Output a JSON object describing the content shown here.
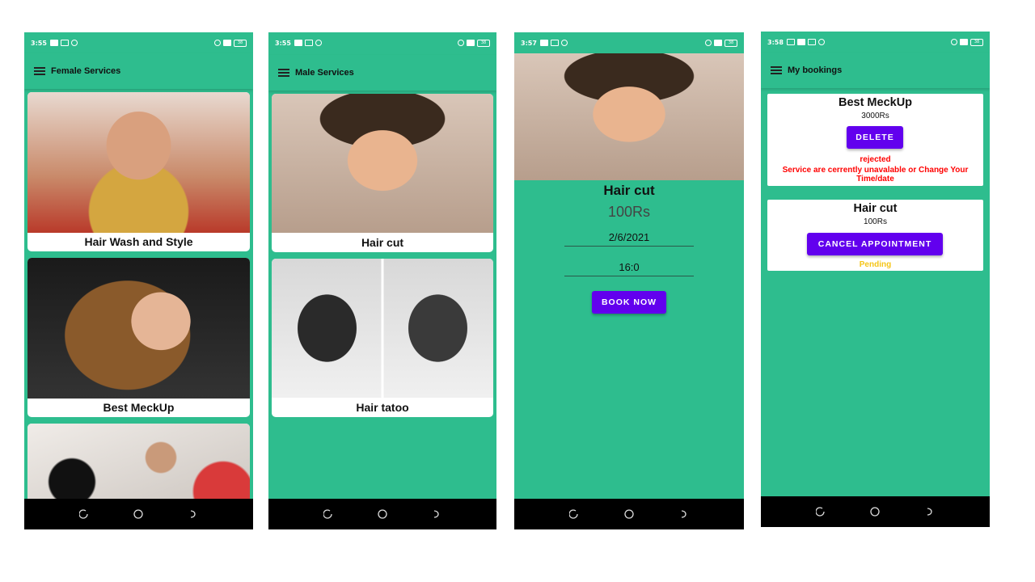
{
  "screens": {
    "female": {
      "time": "3:55",
      "battery": "38",
      "title": "Female Services",
      "cards": [
        "Hair Wash and Style",
        "Best MeckUp"
      ]
    },
    "male": {
      "time": "3:55",
      "battery": "38",
      "title": "Male Services",
      "cards": [
        "Hair cut",
        "Hair tatoo"
      ]
    },
    "detail": {
      "time": "3:57",
      "battery": "38",
      "service_name": "Hair cut",
      "price": "100Rs",
      "date": "2/6/2021",
      "time_value": "16:0",
      "book_button": "BOOK NOW"
    },
    "bookings": {
      "time": "3:58",
      "battery": "38",
      "title": "My bookings",
      "items": [
        {
          "name": "Best MeckUp",
          "price": "3000Rs",
          "button": "DELETE",
          "status": "rejected",
          "message": "Service are cerrently unavalable or Change Your Time/date",
          "status_color": "#ff0000"
        },
        {
          "name": "Hair cut",
          "price": "100Rs",
          "button": "CANCEL APPOINTMENT",
          "status": "Pending",
          "status_color": "#f5c518"
        }
      ]
    }
  },
  "colors": {
    "accent_green": "#2ebd8e",
    "button_purple": "#6200ee"
  }
}
